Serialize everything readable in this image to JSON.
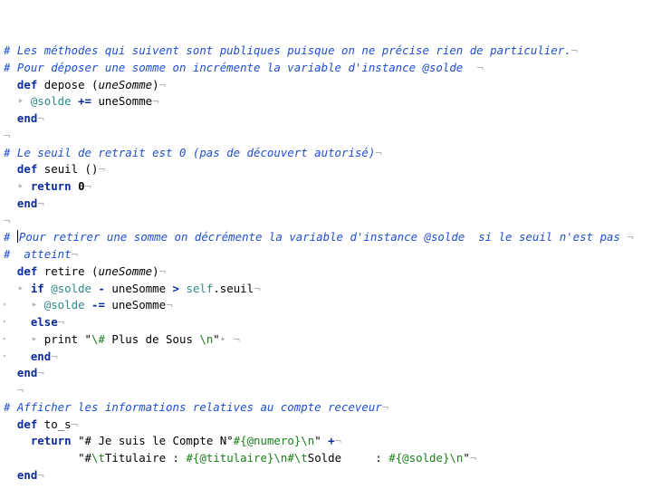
{
  "editor": {
    "lines": [
      {
        "gutter": "",
        "segments": [
          [
            "comment",
            "# Les méthodes qui suivent sont publiques puisque on ne précise rien de particulier."
          ],
          [
            "invis",
            "¬"
          ]
        ]
      },
      {
        "gutter": "",
        "segments": [
          [
            "comment",
            "# Pour déposer une somme on incrémente la variable d'instance @solde  "
          ],
          [
            "invis",
            "¬"
          ]
        ]
      },
      {
        "gutter": "",
        "segments": [
          [
            "ident",
            "  "
          ],
          [
            "keyword",
            "def"
          ],
          [
            "ident",
            " depose "
          ],
          [
            "punct",
            "("
          ],
          [
            "param",
            "uneSomme"
          ],
          [
            "punct",
            ")"
          ],
          [
            "invis",
            "¬"
          ]
        ]
      },
      {
        "gutter": "",
        "segments": [
          [
            "invis",
            "  ‣ "
          ],
          [
            "ivar",
            "@solde"
          ],
          [
            "ident",
            " "
          ],
          [
            "op",
            "+="
          ],
          [
            "ident",
            " uneSomme"
          ],
          [
            "invis",
            "¬"
          ]
        ]
      },
      {
        "gutter": "",
        "segments": [
          [
            "ident",
            "  "
          ],
          [
            "keyword",
            "end"
          ],
          [
            "invis",
            "¬"
          ]
        ]
      },
      {
        "gutter": "",
        "segments": [
          [
            "invis",
            "¬"
          ]
        ]
      },
      {
        "gutter": "",
        "segments": [
          [
            "comment",
            "# Le seuil de retrait est 0 (pas de découvert autorisé)"
          ],
          [
            "invis",
            "¬"
          ]
        ]
      },
      {
        "gutter": "",
        "segments": [
          [
            "ident",
            "  "
          ],
          [
            "keyword",
            "def"
          ],
          [
            "ident",
            " seuil "
          ],
          [
            "punct",
            "()"
          ],
          [
            "invis",
            "¬"
          ]
        ]
      },
      {
        "gutter": "",
        "segments": [
          [
            "invis",
            "  ‣ "
          ],
          [
            "keyword",
            "return"
          ],
          [
            "ident",
            " "
          ],
          [
            "num",
            "0"
          ],
          [
            "invis",
            "¬"
          ]
        ]
      },
      {
        "gutter": "",
        "segments": [
          [
            "ident",
            "  "
          ],
          [
            "keyword",
            "end"
          ],
          [
            "invis",
            "¬"
          ]
        ]
      },
      {
        "gutter": "",
        "segments": [
          [
            "invis",
            "¬"
          ]
        ]
      },
      {
        "gutter": "",
        "caret": true,
        "segments": [
          [
            "comment",
            "# "
          ],
          [
            "caret",
            ""
          ],
          [
            "comment",
            "Pour retirer une somme on décrémente la variable d'instance @solde  si le seuil n'est pas "
          ],
          [
            "invis",
            "¬"
          ]
        ]
      },
      {
        "gutter": "",
        "segments": [
          [
            "comment",
            "#  atteint"
          ],
          [
            "invis",
            "¬"
          ]
        ]
      },
      {
        "gutter": "",
        "segments": [
          [
            "ident",
            "  "
          ],
          [
            "keyword",
            "def"
          ],
          [
            "ident",
            " retire "
          ],
          [
            "punct",
            "("
          ],
          [
            "param",
            "uneSomme"
          ],
          [
            "punct",
            ")"
          ],
          [
            "invis",
            "¬"
          ]
        ]
      },
      {
        "gutter": "",
        "segments": [
          [
            "invis",
            "  ‣ "
          ],
          [
            "keyword",
            "if"
          ],
          [
            "ident",
            " "
          ],
          [
            "ivar",
            "@solde"
          ],
          [
            "ident",
            " "
          ],
          [
            "op",
            "-"
          ],
          [
            "ident",
            " uneSomme "
          ],
          [
            "op",
            ">"
          ],
          [
            "ident",
            " "
          ],
          [
            "self",
            "self"
          ],
          [
            "ident",
            ".seuil"
          ],
          [
            "invis",
            "¬"
          ]
        ]
      },
      {
        "gutter": "‣",
        "segments": [
          [
            "invis",
            "    ‣ "
          ],
          [
            "ivar",
            "@solde"
          ],
          [
            "ident",
            " "
          ],
          [
            "op",
            "-="
          ],
          [
            "ident",
            " uneSomme"
          ],
          [
            "invis",
            "¬"
          ]
        ]
      },
      {
        "gutter": "‣",
        "segments": [
          [
            "ident",
            "    "
          ],
          [
            "keyword",
            "else"
          ],
          [
            "invis",
            "¬"
          ]
        ]
      },
      {
        "gutter": "‣",
        "segments": [
          [
            "invis",
            "    ‣ "
          ],
          [
            "ident",
            "print "
          ],
          [
            "string",
            "\""
          ],
          [
            "escape",
            "\\#"
          ],
          [
            "string",
            " Plus de Sous "
          ],
          [
            "escape",
            "\\n"
          ],
          [
            "string",
            "\""
          ],
          [
            "invis",
            "‣ ¬"
          ]
        ]
      },
      {
        "gutter": "‣",
        "segments": [
          [
            "ident",
            "    "
          ],
          [
            "keyword",
            "end"
          ],
          [
            "invis",
            "¬"
          ]
        ]
      },
      {
        "gutter": "",
        "segments": [
          [
            "ident",
            "  "
          ],
          [
            "keyword",
            "end"
          ],
          [
            "invis",
            "¬"
          ]
        ]
      },
      {
        "gutter": "",
        "segments": [
          [
            "invis",
            "  ¬"
          ]
        ]
      },
      {
        "gutter": "",
        "segments": [
          [
            "comment",
            "# Afficher les informations relatives au compte receveur"
          ],
          [
            "invis",
            "¬"
          ]
        ]
      },
      {
        "gutter": "",
        "segments": [
          [
            "ident",
            "  "
          ],
          [
            "keyword",
            "def"
          ],
          [
            "ident",
            " to_s"
          ],
          [
            "invis",
            "¬"
          ]
        ]
      },
      {
        "gutter": "",
        "segments": [
          [
            "ident",
            "    "
          ],
          [
            "keyword",
            "return"
          ],
          [
            "ident",
            " "
          ],
          [
            "string",
            "\"# Je suis le Compte N°"
          ],
          [
            "interp",
            "#{@numero}"
          ],
          [
            "escape",
            "\\n"
          ],
          [
            "string",
            "\""
          ],
          [
            "ident",
            " "
          ],
          [
            "op",
            "+"
          ],
          [
            "invis",
            "¬"
          ]
        ]
      },
      {
        "gutter": "",
        "segments": [
          [
            "ident",
            "           "
          ],
          [
            "string",
            "\"#"
          ],
          [
            "escape",
            "\\t"
          ],
          [
            "string",
            "Titulaire : "
          ],
          [
            "interp",
            "#{@titulaire}"
          ],
          [
            "escape",
            "\\n#\\t"
          ],
          [
            "string",
            "Solde     : "
          ],
          [
            "interp",
            "#{@solde}"
          ],
          [
            "escape",
            "\\n"
          ],
          [
            "string",
            "\""
          ],
          [
            "invis",
            "¬"
          ]
        ]
      },
      {
        "gutter": "",
        "segments": [
          [
            "ident",
            "  "
          ],
          [
            "keyword",
            "end"
          ],
          [
            "invis",
            "¬"
          ]
        ]
      }
    ]
  }
}
